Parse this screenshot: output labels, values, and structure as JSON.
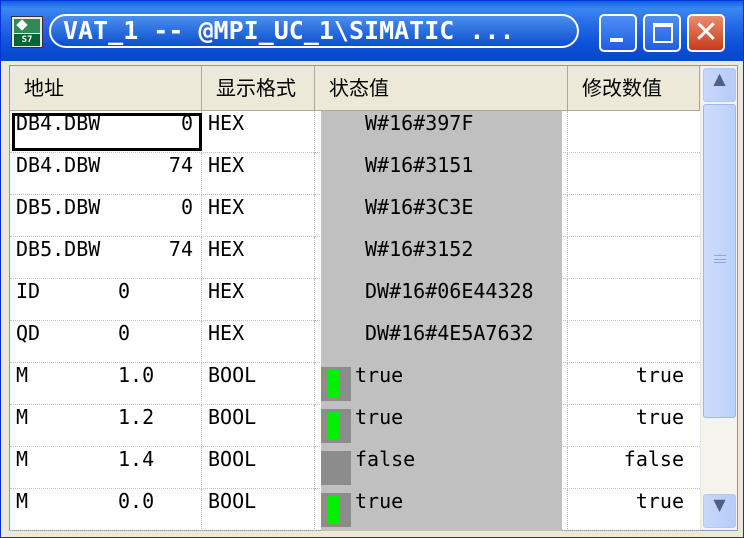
{
  "window": {
    "title": "VAT_1 -- @MPI_UC_1\\SIMATIC ...",
    "icon": "simatic-s7-app-icon",
    "buttons": {
      "minimize": "minimize-icon",
      "maximize": "maximize-icon",
      "close": "✕"
    }
  },
  "table": {
    "headers": {
      "address": "地址",
      "format": "显示格式",
      "status": "状态值",
      "modify": "修改数值"
    },
    "rows": [
      {
        "addr": "DB4.DBW",
        "num": "0",
        "format": "HEX",
        "status": "W#16#397F",
        "modify": "",
        "led": "none"
      },
      {
        "addr": "DB4.DBW",
        "num": "74",
        "format": "HEX",
        "status": "W#16#3151",
        "modify": "",
        "led": "none"
      },
      {
        "addr": "DB5.DBW",
        "num": "0",
        "format": "HEX",
        "status": "W#16#3C3E",
        "modify": "",
        "led": "none"
      },
      {
        "addr": "DB5.DBW",
        "num": "74",
        "format": "HEX",
        "status": "W#16#3152",
        "modify": "",
        "led": "none"
      },
      {
        "addr": "ID",
        "num": "0",
        "format": "HEX",
        "status": "DW#16#06E44328",
        "modify": "",
        "led": "none"
      },
      {
        "addr": "QD",
        "num": "0",
        "format": "HEX",
        "status": "DW#16#4E5A7632",
        "modify": "",
        "led": "none"
      },
      {
        "addr": "M",
        "num": "1.0",
        "format": "BOOL",
        "status": "true",
        "modify": "true",
        "led": "on"
      },
      {
        "addr": "M",
        "num": "1.2",
        "format": "BOOL",
        "status": "true",
        "modify": "true",
        "led": "on"
      },
      {
        "addr": "M",
        "num": "1.4",
        "format": "BOOL",
        "status": "false",
        "modify": "false",
        "led": "off"
      },
      {
        "addr": "M",
        "num": "0.0",
        "format": "BOOL",
        "status": "true",
        "modify": "true",
        "led": "on"
      }
    ]
  },
  "scrollbar": {
    "up": "▲",
    "down": "▼"
  },
  "colors": {
    "titlebar": "#0A46C8",
    "status_bg": "#C0C0C0",
    "led_on": "#00F000",
    "led_well": "#8C8C8C"
  }
}
